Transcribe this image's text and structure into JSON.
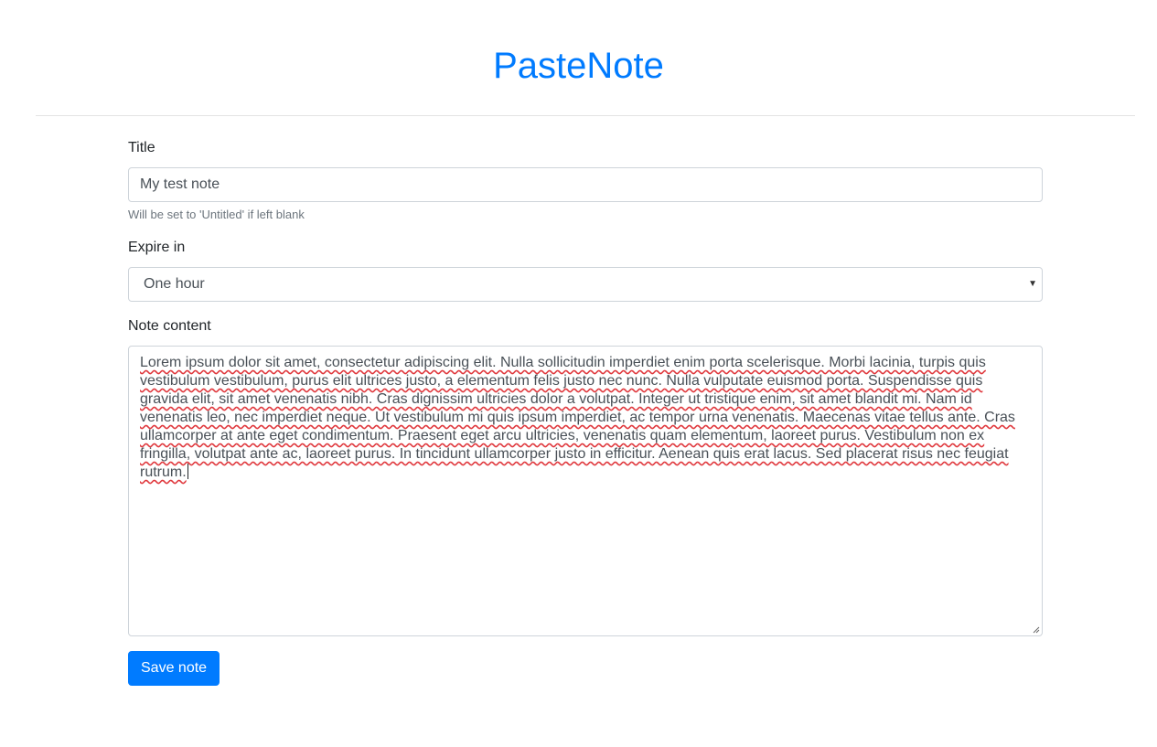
{
  "app": {
    "title": "PasteNote"
  },
  "form": {
    "title_label": "Title",
    "title_value": "My test note",
    "title_help": "Will be set to 'Untitled' if left blank",
    "expire_label": "Expire in",
    "expire_selected": "One hour",
    "content_label": "Note content",
    "content_value": "Lorem ipsum dolor sit amet, consectetur adipiscing elit. Nulla sollicitudin imperdiet enim porta scelerisque. Morbi lacinia, turpis quis vestibulum vestibulum, purus elit ultrices justo, a elementum felis justo nec nunc. Nulla vulputate euismod porta. Suspendisse quis gravida elit, sit amet venenatis nibh. Cras dignissim ultricies dolor a volutpat. Integer ut tristique enim, sit amet blandit mi. Nam id venenatis leo, nec imperdiet neque. Ut vestibulum mi quis ipsum imperdiet, ac tempor urna venenatis. Maecenas vitae tellus ante. Cras ullamcorper at ante eget condimentum. Praesent eget arcu ultricies, venenatis quam elementum, laoreet purus. Vestibulum non ex fringilla, volutpat ante ac, laoreet purus. In tincidunt ullamcorper justo in efficitur. Aenean quis erat lacus. Sed placerat risus nec feugiat rutrum.",
    "save_label": "Save note"
  },
  "icons": {
    "select_arrow": "dropdown-arrow-icon",
    "resize": "resize-grip-icon"
  },
  "colors": {
    "brand": "#007bff",
    "button_bg": "#007bff",
    "spellcheck": "#e0393e"
  }
}
